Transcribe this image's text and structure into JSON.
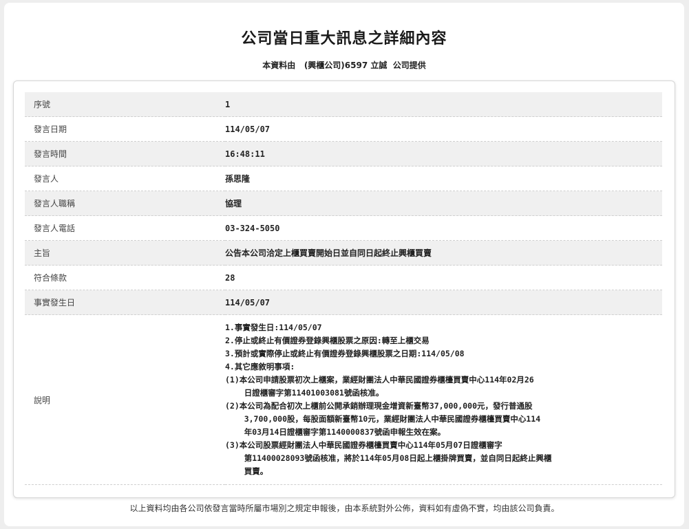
{
  "header": {
    "title": "公司當日重大訊息之詳細內容",
    "subtitle_prefix": "本資料由",
    "subtitle_company": "(興櫃公司)6597 立誠",
    "subtitle_suffix": "公司提供"
  },
  "rows": [
    {
      "label": "序號",
      "value": "1"
    },
    {
      "label": "發言日期",
      "value": "114/05/07"
    },
    {
      "label": "發言時間",
      "value": "16:48:11"
    },
    {
      "label": "發言人",
      "value": "孫思隆"
    },
    {
      "label": "發言人職稱",
      "value": "協理"
    },
    {
      "label": "發言人電話",
      "value": "03-324-5050"
    },
    {
      "label": "主旨",
      "value": "公告本公司洽定上櫃買賣開始日並自同日起終止興櫃買賣"
    },
    {
      "label": "符合條款",
      "value": "28"
    },
    {
      "label": "事實發生日",
      "value": "114/05/07"
    }
  ],
  "description": {
    "label": "說明",
    "lines": [
      "1.事實發生日:114/05/07",
      "2.停止或終止有價證券登錄興櫃股票之原因:轉至上櫃交易",
      "3.預計或實際停止或終止有價證券登錄興櫃股票之日期:114/05/08",
      "4.其它應敘明事項:",
      "(1)本公司申請股票初次上櫃案，業經財團法人中華民國證券櫃檯買賣中心114年02月26",
      "    日證櫃審字第11401003081號函核准。",
      "(2)本公司為配合初次上櫃前公開承銷辦理現金增資新臺幣37,000,000元，發行普通股",
      "    3,700,000股，每股面額新臺幣10元，業經財團法人中華民國證券櫃檯買賣中心114",
      "    年03月14日證櫃審字第1140000837號函申報生效在案。",
      "(3)本公司股票經財團法人中華民國證券櫃檯買賣中心114年05月07日證櫃審字",
      "    第11400028093號函核准，將於114年05月08日起上櫃掛牌買賣，並自同日起終止興櫃",
      "    買賣。"
    ]
  },
  "footer": {
    "text": "以上資料均由各公司依發言當時所屬市場別之規定申報後，由本系統對外公佈，資料如有虛偽不實，均由該公司負責。"
  }
}
